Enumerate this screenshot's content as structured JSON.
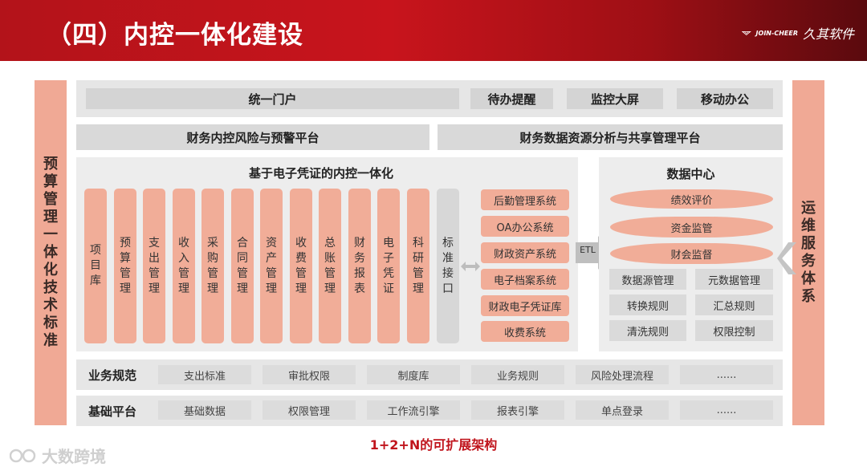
{
  "header": {
    "title": "（四）内控一体化建设",
    "logo_en": "JOIN-CHEER",
    "logo_cn": "久其软件"
  },
  "side_left": "预算管理一体化技术标准",
  "side_right": "运维服务体系",
  "top_row": {
    "portal": "统一门户",
    "todo": "待办提醒",
    "screen": "监控大屏",
    "mobile": "移动办公"
  },
  "platforms": {
    "risk": "财务内控风险与预警平台",
    "analysis": "财务数据资源分析与共享管理平台"
  },
  "voucher_panel": {
    "title": "基于电子凭证的内控一体化",
    "columns": [
      "项目库",
      "预算管理",
      "支出管理",
      "收入管理",
      "采购管理",
      "合同管理",
      "资产管理",
      "收费管理",
      "总账管理",
      "财务报表",
      "电子凭证",
      "科研管理"
    ],
    "interface": "标准接口",
    "systems": [
      "后勤管理系统",
      "OA办公系统",
      "财政资产系统",
      "电子档案系统",
      "财政电子凭证库",
      "收费系统"
    ]
  },
  "etl_label": "ETL",
  "data_center": {
    "title": "数据中心",
    "layers": [
      "绩效评价",
      "资金监管",
      "财会监督"
    ],
    "grid": [
      "数据源管理",
      "元数据管理",
      "转换规则",
      "汇总规则",
      "清洗规则",
      "权限控制"
    ]
  },
  "business_rules": {
    "label": "业务规范",
    "items": [
      "支出标准",
      "审批权限",
      "制度库",
      "业务规则",
      "风险处理流程",
      "......"
    ]
  },
  "base_platform": {
    "label": "基础平台",
    "items": [
      "基础数据",
      "权限管理",
      "工作流引擎",
      "报表引擎",
      "单点登录",
      "......"
    ]
  },
  "footer": "1+2+N的可扩展架构",
  "watermark": "大数跨境",
  "colors": {
    "brand_red": "#c0141c",
    "salmon": "#f1ad98",
    "panel_gray": "#ededed"
  }
}
